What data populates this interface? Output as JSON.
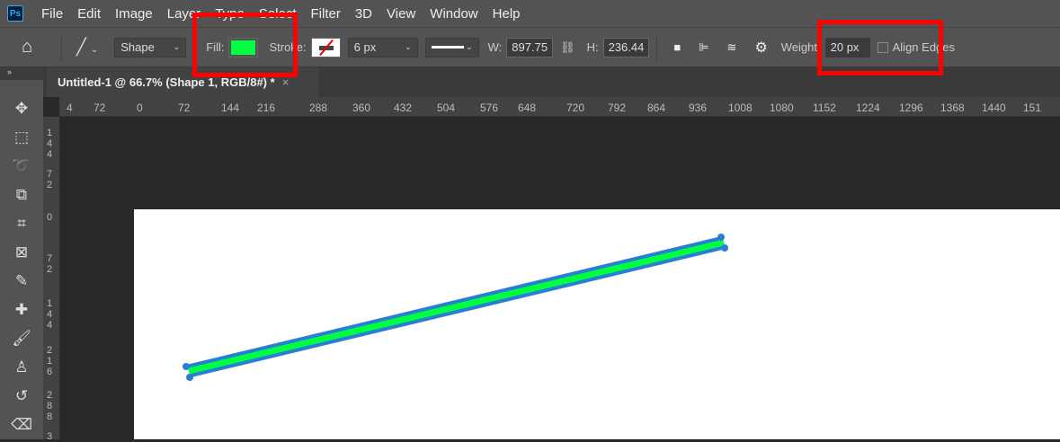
{
  "menu": [
    "File",
    "Edit",
    "Image",
    "Layer",
    "Type",
    "Select",
    "Filter",
    "3D",
    "View",
    "Window",
    "Help"
  ],
  "app_logo": "Ps",
  "options": {
    "mode": "Shape",
    "fill_label": "Fill:",
    "fill_color": "#00ff41",
    "stroke_label": "Stroke:",
    "stroke_width": "6 px",
    "w_label": "W:",
    "w_value": "897.75",
    "h_label": "H:",
    "h_value": "236.44",
    "weight_label": "Weight:",
    "weight_value": "20 px",
    "align_edges_label": "Align Edges",
    "align_edges_checked": false
  },
  "document_tab": {
    "title": "Untitled-1 @ 66.7% (Shape 1, RGB/8#) *",
    "close": "×"
  },
  "hruler": [
    "4",
    "72",
    "0",
    "72",
    "144",
    "216",
    "288",
    "360",
    "432",
    "504",
    "576",
    "648",
    "720",
    "792",
    "864",
    "936",
    "1008",
    "1080",
    "1152",
    "1224",
    "1296",
    "1368",
    "1440",
    "151"
  ],
  "vruler": [
    "1\n4\n4",
    "7\n2",
    "0",
    "7\n2",
    "1\n4\n4",
    "2\n1\n6",
    "2\n8\n8",
    "3"
  ],
  "colors": {
    "line_fill": "#00ff41",
    "line_stroke": "#2a7fd4",
    "highlight": "#ff0000"
  }
}
